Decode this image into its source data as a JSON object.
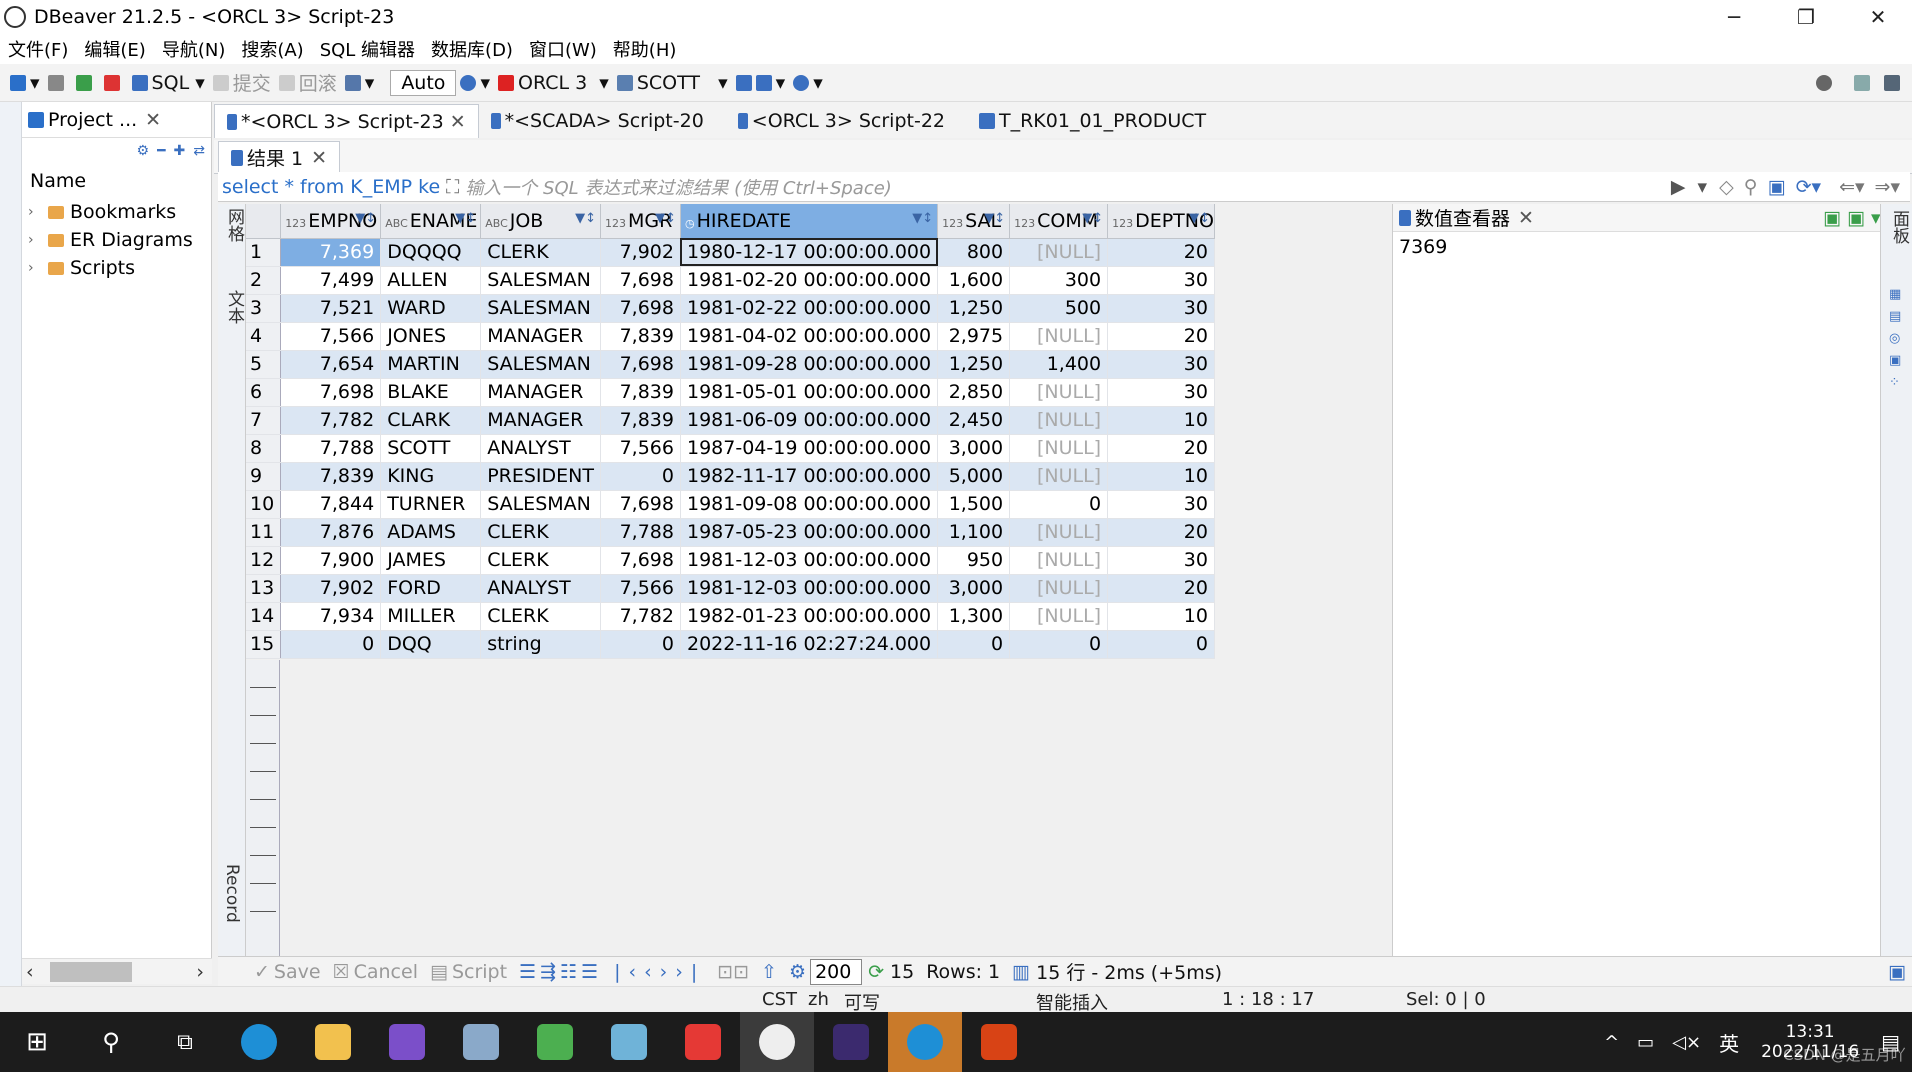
{
  "window": {
    "title": "DBeaver 21.2.5 - <ORCL 3> Script-23",
    "minimize": "─",
    "restore": "❐",
    "close": "✕"
  },
  "menu": [
    "文件(F)",
    "编辑(E)",
    "导航(N)",
    "搜索(A)",
    "SQL 编辑器",
    "数据库(D)",
    "窗口(W)",
    "帮助(H)"
  ],
  "toolbar": {
    "sql": "SQL",
    "commit": "提交",
    "rollback": "回滚",
    "auto": "Auto",
    "connection": "ORCL 3",
    "schema": "SCOTT"
  },
  "project": {
    "tab": "Project ...",
    "header": "Name",
    "items": [
      "Bookmarks",
      "ER Diagrams",
      "Scripts"
    ]
  },
  "editor_tabs": [
    "*<ORCL 3> Script-23",
    "*<SCADA> Script-20",
    "<ORCL 3> Script-22",
    "T_RK01_01_PRODUCT"
  ],
  "result_tab": "结果 1",
  "filter": {
    "query": "select * from K_EMP ke",
    "placeholder": "输入一个 SQL 表达式来过滤结果 (使用 Ctrl+Space)"
  },
  "side_tabs": {
    "grid": "网格",
    "text": "文本",
    "record": "Record"
  },
  "grid": {
    "columns": [
      {
        "name": "EMPNO",
        "type": "123"
      },
      {
        "name": "ENAME",
        "type": "ABC"
      },
      {
        "name": "JOB",
        "type": "ABC"
      },
      {
        "name": "MGR",
        "type": "123"
      },
      {
        "name": "HIREDATE",
        "type": "◷"
      },
      {
        "name": "SAL",
        "type": "123"
      },
      {
        "name": "COMM",
        "type": "123"
      },
      {
        "name": "DEPTNO",
        "type": "123"
      }
    ],
    "rows": [
      [
        "1",
        "7,369",
        "DQQQQ",
        "CLERK",
        "7,902",
        "1980-12-17 00:00:00.000",
        "800",
        "[NULL]",
        "20"
      ],
      [
        "2",
        "7,499",
        "ALLEN",
        "SALESMAN",
        "7,698",
        "1981-02-20 00:00:00.000",
        "1,600",
        "300",
        "30"
      ],
      [
        "3",
        "7,521",
        "WARD",
        "SALESMAN",
        "7,698",
        "1981-02-22 00:00:00.000",
        "1,250",
        "500",
        "30"
      ],
      [
        "4",
        "7,566",
        "JONES",
        "MANAGER",
        "7,839",
        "1981-04-02 00:00:00.000",
        "2,975",
        "[NULL]",
        "20"
      ],
      [
        "5",
        "7,654",
        "MARTIN",
        "SALESMAN",
        "7,698",
        "1981-09-28 00:00:00.000",
        "1,250",
        "1,400",
        "30"
      ],
      [
        "6",
        "7,698",
        "BLAKE",
        "MANAGER",
        "7,839",
        "1981-05-01 00:00:00.000",
        "2,850",
        "[NULL]",
        "30"
      ],
      [
        "7",
        "7,782",
        "CLARK",
        "MANAGER",
        "7,839",
        "1981-06-09 00:00:00.000",
        "2,450",
        "[NULL]",
        "10"
      ],
      [
        "8",
        "7,788",
        "SCOTT",
        "ANALYST",
        "7,566",
        "1987-04-19 00:00:00.000",
        "3,000",
        "[NULL]",
        "20"
      ],
      [
        "9",
        "7,839",
        "KING",
        "PRESIDENT",
        "0",
        "1982-11-17 00:00:00.000",
        "5,000",
        "[NULL]",
        "10"
      ],
      [
        "10",
        "7,844",
        "TURNER",
        "SALESMAN",
        "7,698",
        "1981-09-08 00:00:00.000",
        "1,500",
        "0",
        "30"
      ],
      [
        "11",
        "7,876",
        "ADAMS",
        "CLERK",
        "7,788",
        "1987-05-23 00:00:00.000",
        "1,100",
        "[NULL]",
        "20"
      ],
      [
        "12",
        "7,900",
        "JAMES",
        "CLERK",
        "7,698",
        "1981-12-03 00:00:00.000",
        "950",
        "[NULL]",
        "30"
      ],
      [
        "13",
        "7,902",
        "FORD",
        "ANALYST",
        "7,566",
        "1981-12-03 00:00:00.000",
        "3,000",
        "[NULL]",
        "20"
      ],
      [
        "14",
        "7,934",
        "MILLER",
        "CLERK",
        "7,782",
        "1982-01-23 00:00:00.000",
        "1,300",
        "[NULL]",
        "10"
      ],
      [
        "15",
        "0",
        "DQQ",
        "string",
        "0",
        "2022-11-16 02:27:24.000",
        "0",
        "0",
        "0"
      ]
    ]
  },
  "viewer": {
    "title": "数值查看器",
    "value": "7369"
  },
  "bottom": {
    "save": "Save",
    "cancel": "Cancel",
    "script": "Script",
    "limit": "200",
    "count": "15",
    "rows": "Rows: 1",
    "summary": "15 行 - 2ms (+5ms)"
  },
  "status": {
    "tz": "CST",
    "lang": "zh",
    "mode": "可写",
    "insert": "智能插入",
    "pos": "1 : 18 : 17",
    "sel": "Sel: 0 | 0"
  },
  "taskbar": {
    "lang": "英",
    "time": "13:31",
    "date": "2022/11/16",
    "watermark": "CSDN @是五月吖"
  }
}
